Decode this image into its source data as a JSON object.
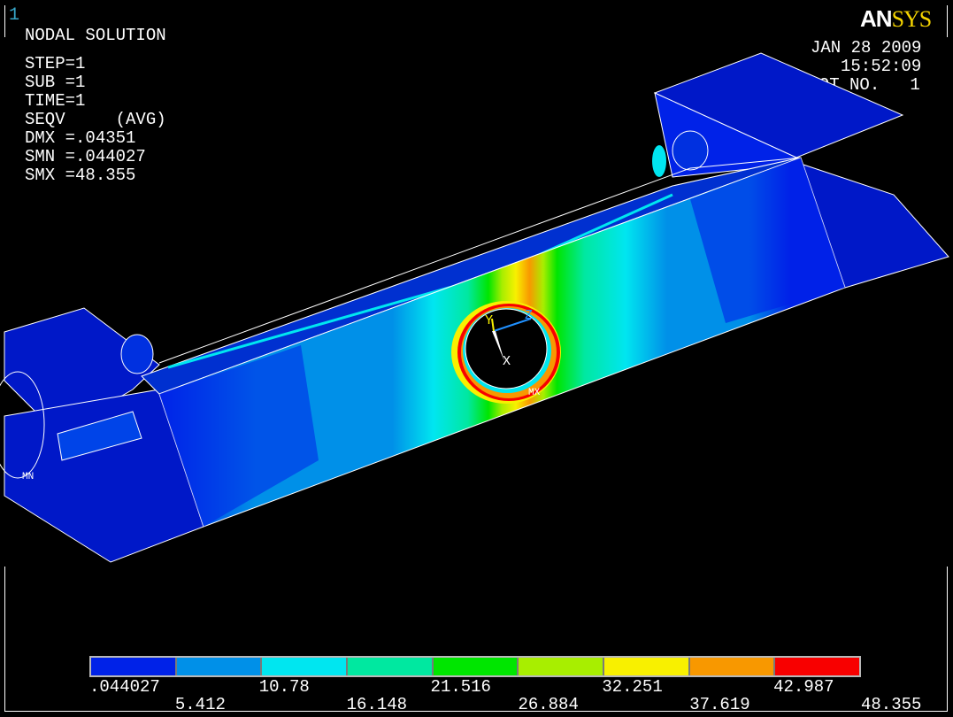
{
  "window_number": "1",
  "logo": {
    "part1": "AN",
    "part2": "SYS"
  },
  "info": {
    "title": "NODAL SOLUTION",
    "lines": [
      "STEP=1",
      "SUB =1",
      "TIME=1",
      "SEQV     (AVG)",
      "DMX =.04351",
      "SMN =.044027",
      "SMX =48.355"
    ]
  },
  "stamp": {
    "date": "JAN 28 2009",
    "time": "15:52:09",
    "plot": "PLOT NO.   1"
  },
  "markers": {
    "min": "MN",
    "max": "MX"
  },
  "triad": {
    "x": "X",
    "y": "Y",
    "z": "Z"
  },
  "legend": {
    "colors": [
      "#0022e8",
      "#0090e8",
      "#00e6f0",
      "#00e8a0",
      "#00e600",
      "#a8ee00",
      "#f8f000",
      "#f89800",
      "#f80000"
    ],
    "ticks_top": [
      ".044027",
      "10.78",
      "21.516",
      "32.251",
      "42.987"
    ],
    "ticks_bottom": [
      "5.412",
      "16.148",
      "26.884",
      "37.619",
      "48.355"
    ]
  }
}
